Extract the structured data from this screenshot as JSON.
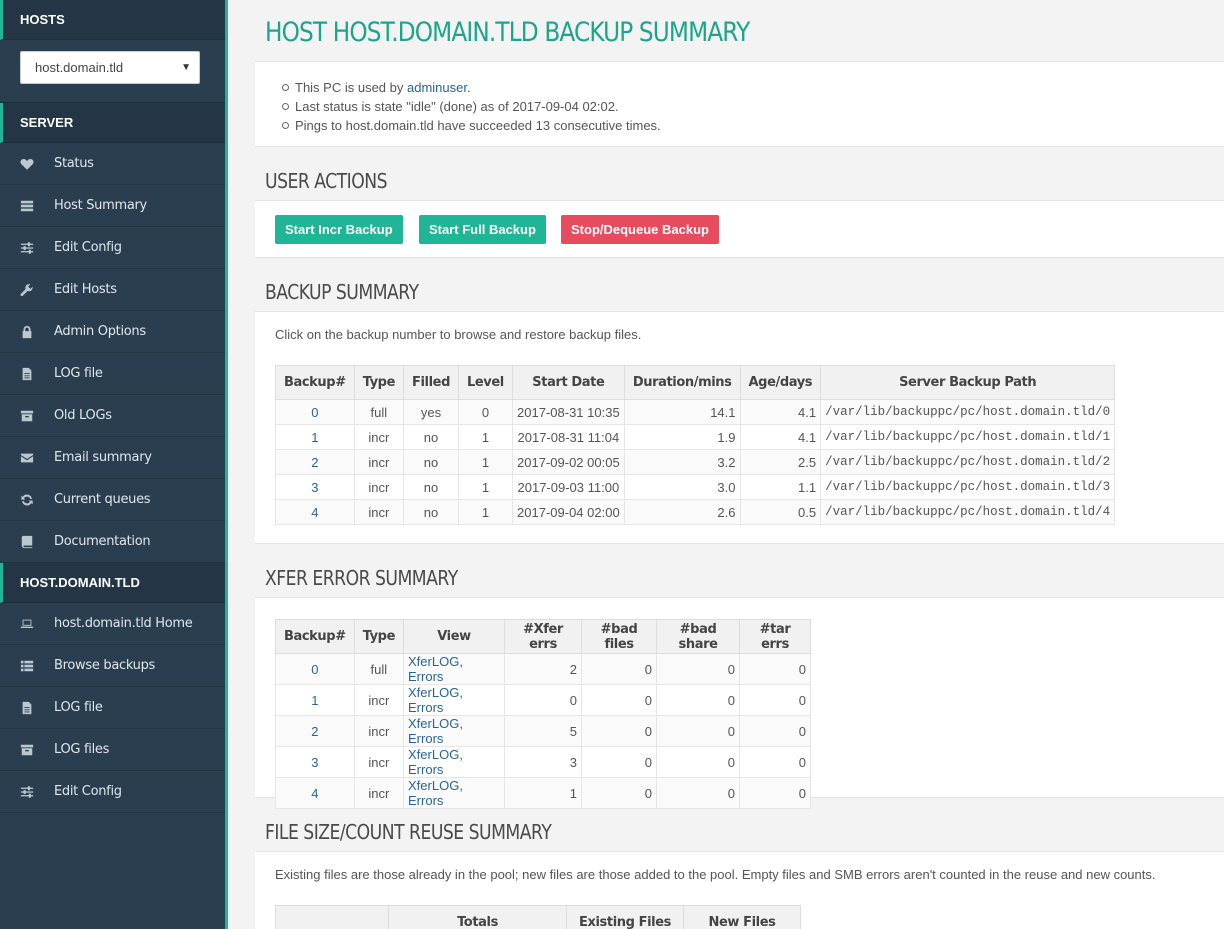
{
  "sidebar": {
    "hosts_header": "HOSTS",
    "host_select_value": "host.domain.tld",
    "server_header": "SERVER",
    "server_items": [
      {
        "label": "Status",
        "icon": "heartbeat-icon"
      },
      {
        "label": "Host Summary",
        "icon": "server-icon"
      },
      {
        "label": "Edit Config",
        "icon": "sliders-icon"
      },
      {
        "label": "Edit Hosts",
        "icon": "wrench-icon"
      },
      {
        "label": "Admin Options",
        "icon": "lock-icon"
      },
      {
        "label": "LOG file",
        "icon": "file-icon"
      },
      {
        "label": "Old LOGs",
        "icon": "archive-icon"
      },
      {
        "label": "Email summary",
        "icon": "envelope-icon"
      },
      {
        "label": "Current queues",
        "icon": "refresh-icon"
      },
      {
        "label": "Documentation",
        "icon": "book-icon"
      }
    ],
    "host_header": "HOST.DOMAIN.TLD",
    "host_items": [
      {
        "label": "host.domain.tld Home",
        "icon": "laptop-icon"
      },
      {
        "label": "Browse backups",
        "icon": "list-icon"
      },
      {
        "label": "LOG file",
        "icon": "file-icon"
      },
      {
        "label": "LOG files",
        "icon": "archive-icon"
      },
      {
        "label": "Edit Config",
        "icon": "sliders-icon"
      }
    ]
  },
  "main": {
    "page_title": "HOST HOST.DOMAIN.TLD BACKUP SUMMARY",
    "info": {
      "line1_prefix": "This PC is used by ",
      "line1_user": "adminuser",
      "line1_suffix": ".",
      "line2": "Last status is state \"idle\" (done) as of 2017-09-04 02:02.",
      "line3": "Pings to host.domain.tld have succeeded 13 consecutive times."
    },
    "user_actions": {
      "title": "USER ACTIONS",
      "start_incr": "Start Incr Backup",
      "start_full": "Start Full Backup",
      "stop": "Stop/Dequeue Backup"
    },
    "backup_summary": {
      "title": "BACKUP SUMMARY",
      "note": "Click on the backup number to browse and restore backup files.",
      "headers": [
        "Backup#",
        "Type",
        "Filled",
        "Level",
        "Start Date",
        "Duration/mins",
        "Age/days",
        "Server Backup Path"
      ],
      "rows": [
        [
          "0",
          "full",
          "yes",
          "0",
          "2017-08-31 10:35",
          "14.1",
          "4.1",
          "/var/lib/backuppc/pc/host.domain.tld/0"
        ],
        [
          "1",
          "incr",
          "no",
          "1",
          "2017-08-31 11:04",
          "1.9",
          "4.1",
          "/var/lib/backuppc/pc/host.domain.tld/1"
        ],
        [
          "2",
          "incr",
          "no",
          "1",
          "2017-09-02 00:05",
          "3.2",
          "2.5",
          "/var/lib/backuppc/pc/host.domain.tld/2"
        ],
        [
          "3",
          "incr",
          "no",
          "1",
          "2017-09-03 11:00",
          "3.0",
          "1.1",
          "/var/lib/backuppc/pc/host.domain.tld/3"
        ],
        [
          "4",
          "incr",
          "no",
          "1",
          "2017-09-04 02:00",
          "2.6",
          "0.5",
          "/var/lib/backuppc/pc/host.domain.tld/4"
        ]
      ]
    },
    "xfer_summary": {
      "title": "XFER ERROR SUMMARY",
      "headers": [
        "Backup#",
        "Type",
        "View",
        "#Xfer errs",
        "#bad files",
        "#bad share",
        "#tar errs"
      ],
      "view_xferlog": "XferLOG",
      "view_sep": ", ",
      "view_errors": "Errors",
      "rows": [
        [
          "0",
          "full",
          "2",
          "0",
          "0",
          "0"
        ],
        [
          "1",
          "incr",
          "0",
          "0",
          "0",
          "0"
        ],
        [
          "2",
          "incr",
          "5",
          "0",
          "0",
          "0"
        ],
        [
          "3",
          "incr",
          "3",
          "0",
          "0",
          "0"
        ],
        [
          "4",
          "incr",
          "1",
          "0",
          "0",
          "0"
        ]
      ]
    },
    "reuse_summary": {
      "title": "FILE SIZE/COUNT REUSE SUMMARY",
      "note": "Existing files are those already in the pool; new files are those added to the pool. Empty files and SMB errors aren't counted in the reuse and new counts.",
      "headers": [
        "",
        "Totals",
        "Existing Files",
        "New Files"
      ]
    }
  }
}
